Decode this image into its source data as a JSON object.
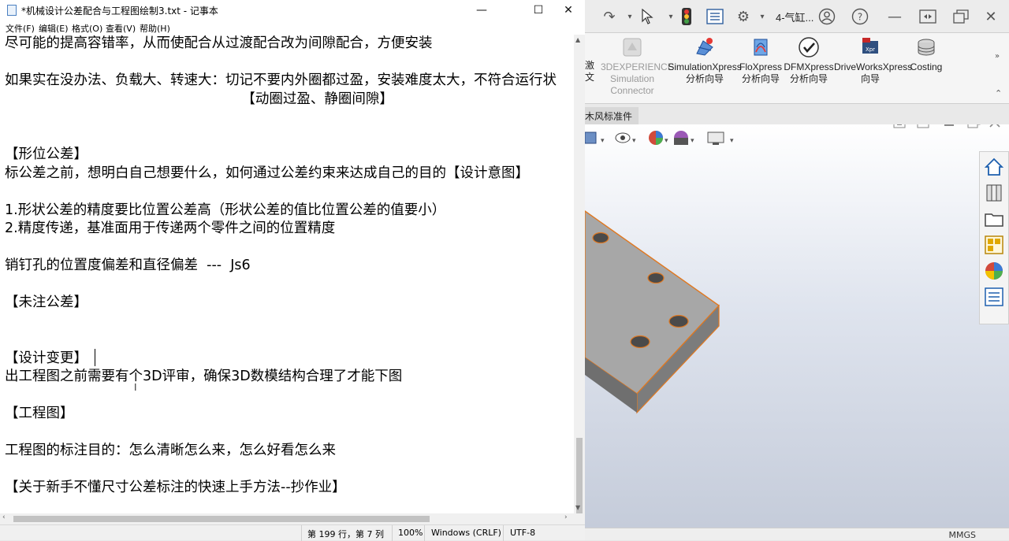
{
  "notepad": {
    "title": "*机械设计公差配合与工程图绘制3.txt - 记事本",
    "window_buttons": {
      "minimize": "—",
      "maximize": "☐",
      "close": "✕"
    },
    "menu": [
      "文件(F)",
      "编辑(E)",
      "格式(O)",
      "查看(V)",
      "帮助(H)"
    ],
    "lines": [
      "尽可能的提高容错率，从而使配合从过渡配合改为间隙配合，方便安装",
      "",
      "如果实在没办法、负载大、转速大：切记不要内外圈都过盈，安装难度太大，不符合运行状",
      "                                                      【动圈过盈、静圈间隙】",
      "",
      "",
      "【形位公差】",
      "标公差之前，想明白自己想要什么，如何通过公差约束来达成自己的目的【设计意图】",
      "",
      "1.形状公差的精度要比位置公差高（形状公差的值比位置公差的值要小）",
      "2.精度传递，基准面用于传递两个零件之间的位置精度",
      "",
      "销钉孔的位置度偏差和直径偏差  ---  Js6",
      "",
      "【未注公差】",
      "",
      "",
      "【设计变更】",
      "出工程图之前需要有个3D评审，确保3D数模结构合理了才能下图",
      "",
      "【工程图】",
      "",
      "工程图的标注目的：怎么清晰怎么来，怎么好看怎么来",
      "",
      "【关于新手不懂尺寸公差标注的快速上手方法--抄作业】"
    ],
    "status": {
      "position": "第 199 行，第 7 列",
      "zoom": "100%",
      "line_ending": "Windows (CRLF)",
      "encoding": "UTF-8"
    }
  },
  "solidworks": {
    "doc_title": "4-气缸...",
    "ribbon": [
      {
        "label1": "激",
        "label2": "文",
        "label3": "",
        "disabled": false
      },
      {
        "label1": "3DEXPERIENCE",
        "label2": "Simulation",
        "label3": "Connector",
        "disabled": true
      },
      {
        "label1": "SimulationXpress",
        "label2": "分析向导",
        "label3": "",
        "disabled": false
      },
      {
        "label1": "FloXpress",
        "label2": "分析向导",
        "label3": "",
        "disabled": false
      },
      {
        "label1": "DFMXpress",
        "label2": "分析向导",
        "label3": "",
        "disabled": false
      },
      {
        "label1": "DriveWorksXpress",
        "label2": "向导",
        "label3": "",
        "disabled": false
      },
      {
        "label1": "Costing",
        "label2": "",
        "label3": "",
        "disabled": false
      }
    ],
    "tab_label": "木风标准件",
    "units": "MMGS",
    "colors": {
      "part_edge": "#e07820",
      "part_face": "#8f8f8f",
      "viewport_bottom": "#c5ccda"
    }
  }
}
